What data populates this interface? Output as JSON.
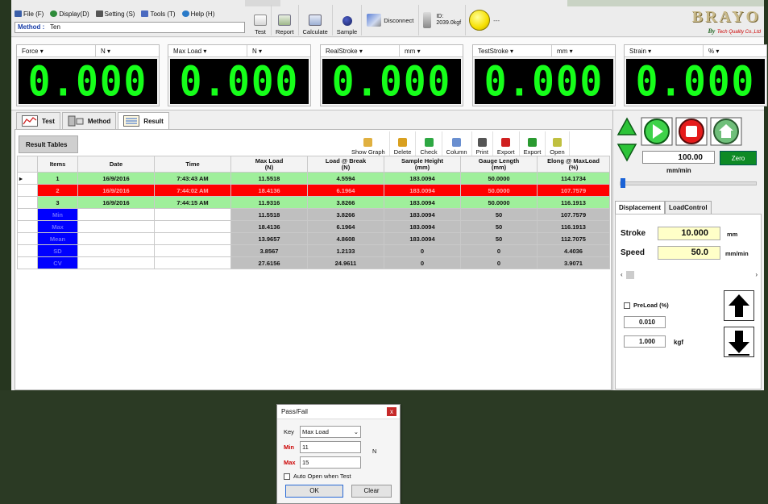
{
  "menu": [
    {
      "label": "File (F)",
      "icon": "file-menu-icon"
    },
    {
      "label": "Display(D)",
      "icon": "display-menu-icon"
    },
    {
      "label": "Setting (S)",
      "icon": "setting-menu-icon"
    },
    {
      "label": "Tools (T)",
      "icon": "tools-menu-icon"
    },
    {
      "label": "Help (H)",
      "icon": "help-menu-icon"
    }
  ],
  "method": {
    "label": "Method :",
    "value": "Ten"
  },
  "toolbar": {
    "test": "Test",
    "report": "Report",
    "calculate": "Calculate",
    "sample": "Sample",
    "disconnect": "Disconnect",
    "sensor_id": "ID:",
    "sensor_cap": "2039.0kgf",
    "lamp_dash": "---"
  },
  "logo": {
    "brand": "BRAYO",
    "by": "By",
    "sub": "Tech Quality Co.,Ltd"
  },
  "readouts": [
    {
      "quantity": "Force",
      "unit": "N",
      "value": "0.000"
    },
    {
      "quantity": "Max Load",
      "unit": "N",
      "value": "0.000"
    },
    {
      "quantity": "RealStroke",
      "unit": "mm",
      "value": "0.000"
    },
    {
      "quantity": "TestStroke",
      "unit": "mm",
      "value": "0.000"
    },
    {
      "quantity": "Strain",
      "unit": "%",
      "value": "0.000"
    }
  ],
  "tabs": {
    "test": "Test",
    "method": "Method",
    "result": "Result"
  },
  "result_tables_label": "Result Tables",
  "result_tools": [
    "Show Graph",
    "Delete",
    "Check",
    "Column",
    "Print",
    "Export",
    "Export",
    "Open"
  ],
  "columns": [
    "Items",
    "Date",
    "Time",
    "Max Load\n(N)",
    "Load @ Break\n(N)",
    "Sample Height\n(mm)",
    "Gauge Length\n(mm)",
    "Elong @ MaxLoad\n(%)"
  ],
  "rows": [
    {
      "status": "pass",
      "cells": [
        "1",
        "16/9/2016",
        "7:43:43 AM",
        "11.5518",
        "4.5594",
        "183.0094",
        "50.0000",
        "114.1734"
      ]
    },
    {
      "status": "fail",
      "cells": [
        "2",
        "16/9/2016",
        "7:44:02 AM",
        "18.4136",
        "6.1964",
        "183.0094",
        "50.0000",
        "107.7579"
      ]
    },
    {
      "status": "pass",
      "cells": [
        "3",
        "16/9/2016",
        "7:44:15 AM",
        "11.9316",
        "3.8266",
        "183.0094",
        "50.0000",
        "116.1913"
      ]
    }
  ],
  "stats": [
    {
      "label": "Min",
      "cells": [
        "11.5518",
        "3.8266",
        "183.0094",
        "50",
        "107.7579"
      ]
    },
    {
      "label": "Max",
      "cells": [
        "18.4136",
        "6.1964",
        "183.0094",
        "50",
        "116.1913"
      ]
    },
    {
      "label": "Mean",
      "cells": [
        "13.9657",
        "4.8608",
        "183.0094",
        "50",
        "112.7075"
      ]
    },
    {
      "label": "SD",
      "cells": [
        "3.8567",
        "1.2133",
        "0",
        "0",
        "4.4036"
      ]
    },
    {
      "label": "CV",
      "cells": [
        "27.6156",
        "24.9611",
        "0",
        "0",
        "3.9071"
      ]
    }
  ],
  "dialog": {
    "title": "Pass/Fail",
    "close": "x",
    "key_label": "Key",
    "key_value": "Max Load",
    "min_label": "Min",
    "min_value": "11",
    "max_label": "Max",
    "max_value": "15",
    "unit": "N",
    "auto_open": "Auto Open when Test",
    "ok": "OK",
    "clear": "Clear"
  },
  "control": {
    "speed": "100.00",
    "speed_unit": "mm/min",
    "zero": "Zero",
    "tab_disp": "Displacement",
    "tab_load": "LoadControl",
    "stroke_label": "Stroke",
    "stroke": "10.000",
    "stroke_unit": "mm",
    "speed_label": "Speed",
    "speed2": "50.0",
    "speed2_unit": "mm/min",
    "preload_label": "PreLoad (%)",
    "preload": "0.010",
    "load_val": "1.000",
    "load_unit": "kgf"
  },
  "colors": {
    "lcd_bg": "#000000",
    "lcd_digit": "#16ff1a",
    "pass_row": "#9fef9b",
    "fail_row": "#ff0000",
    "stat_label": "#0000ff",
    "zero_btn": "#0d8a25"
  }
}
